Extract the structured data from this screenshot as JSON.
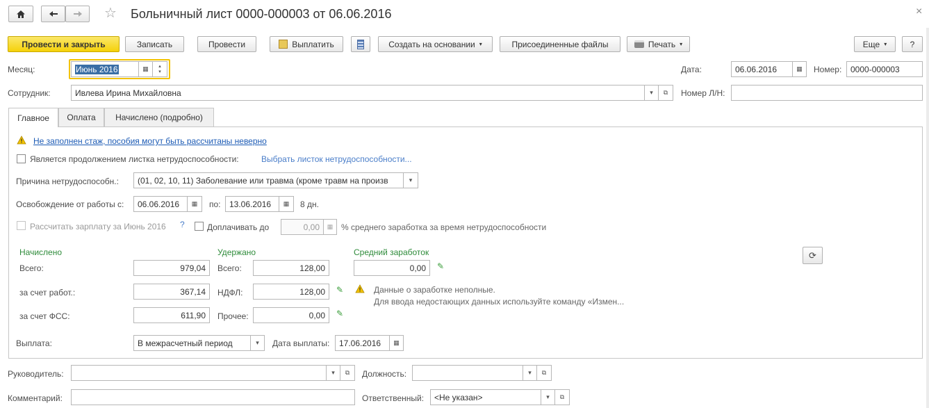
{
  "window": {
    "title": "Больничный лист 0000-000003 от 06.06.2016"
  },
  "toolbar": {
    "post_close": "Провести и закрыть",
    "save": "Записать",
    "post": "Провести",
    "pay": "Выплатить",
    "create_based": "Создать на основании",
    "attached_files": "Присоединенные файлы",
    "print": "Печать",
    "more": "Еще",
    "help": "?"
  },
  "header": {
    "month_label": "Месяц:",
    "month_value": "Июнь 2016",
    "date_label": "Дата:",
    "date_value": "06.06.2016",
    "number_label": "Номер:",
    "number_value": "0000-000003",
    "employee_label": "Сотрудник:",
    "employee_value": "Ивлева Ирина Михайловна",
    "ln_number_label": "Номер Л/Н:",
    "ln_number_value": ""
  },
  "tabs": [
    "Главное",
    "Оплата",
    "Начислено (подробно)"
  ],
  "main": {
    "warning_link": "Не заполнен стаж, пособия могут быть рассчитаны неверно",
    "continuation_label": "Является продолжением листка нетрудоспособности:",
    "choose_sheet_link": "Выбрать листок нетрудоспособности...",
    "reason_label": "Причина нетрудоспособн.:",
    "reason_value": "(01, 02, 10, 11) Заболевание или травма (кроме травм на произв",
    "release_label": "Освобождение от работы с:",
    "release_from": "06.06.2016",
    "release_to_label": "по:",
    "release_to": "13.06.2016",
    "days": "8 дн.",
    "calc_salary_label": "Рассчитать зарплату за Июнь 2016",
    "calc_help": "?",
    "extra_pay_label": "Доплачивать до",
    "extra_pay_value": "0,00",
    "extra_pay_suffix": "% среднего заработка за время нетрудоспособности",
    "accrued_title": "Начислено",
    "total_label": "Всего:",
    "total_value": "979,04",
    "employer_label": "за счет работ.:",
    "employer_value": "367,14",
    "fss_label": "за счет ФСС:",
    "fss_value": "611,90",
    "withheld_title": "Удержано",
    "withheld_total_label": "Всего:",
    "withheld_total_value": "128,00",
    "ndfl_label": "НДФЛ:",
    "ndfl_value": "128,00",
    "other_label": "Прочее:",
    "other_value": "0,00",
    "avg_title": "Средний заработок",
    "avg_value": "0,00",
    "avg_warning_line1": "Данные о заработке неполные.",
    "avg_warning_line2": "Для ввода недостающих данных используйте команду «Измен...",
    "payment_label": "Выплата:",
    "payment_value": "В межрасчетный период",
    "payment_date_label": "Дата выплаты:",
    "payment_date_value": "17.06.2016"
  },
  "footer": {
    "manager_label": "Руководитель:",
    "manager_value": "",
    "position_label": "Должность:",
    "position_value": "",
    "comment_label": "Комментарий:",
    "comment_value": "",
    "responsible_label": "Ответственный:",
    "responsible_value": "<Не указан>"
  },
  "colors": {
    "accent": "#f5d10a",
    "link": "#1c5bb5",
    "green": "#2e8b3a"
  }
}
